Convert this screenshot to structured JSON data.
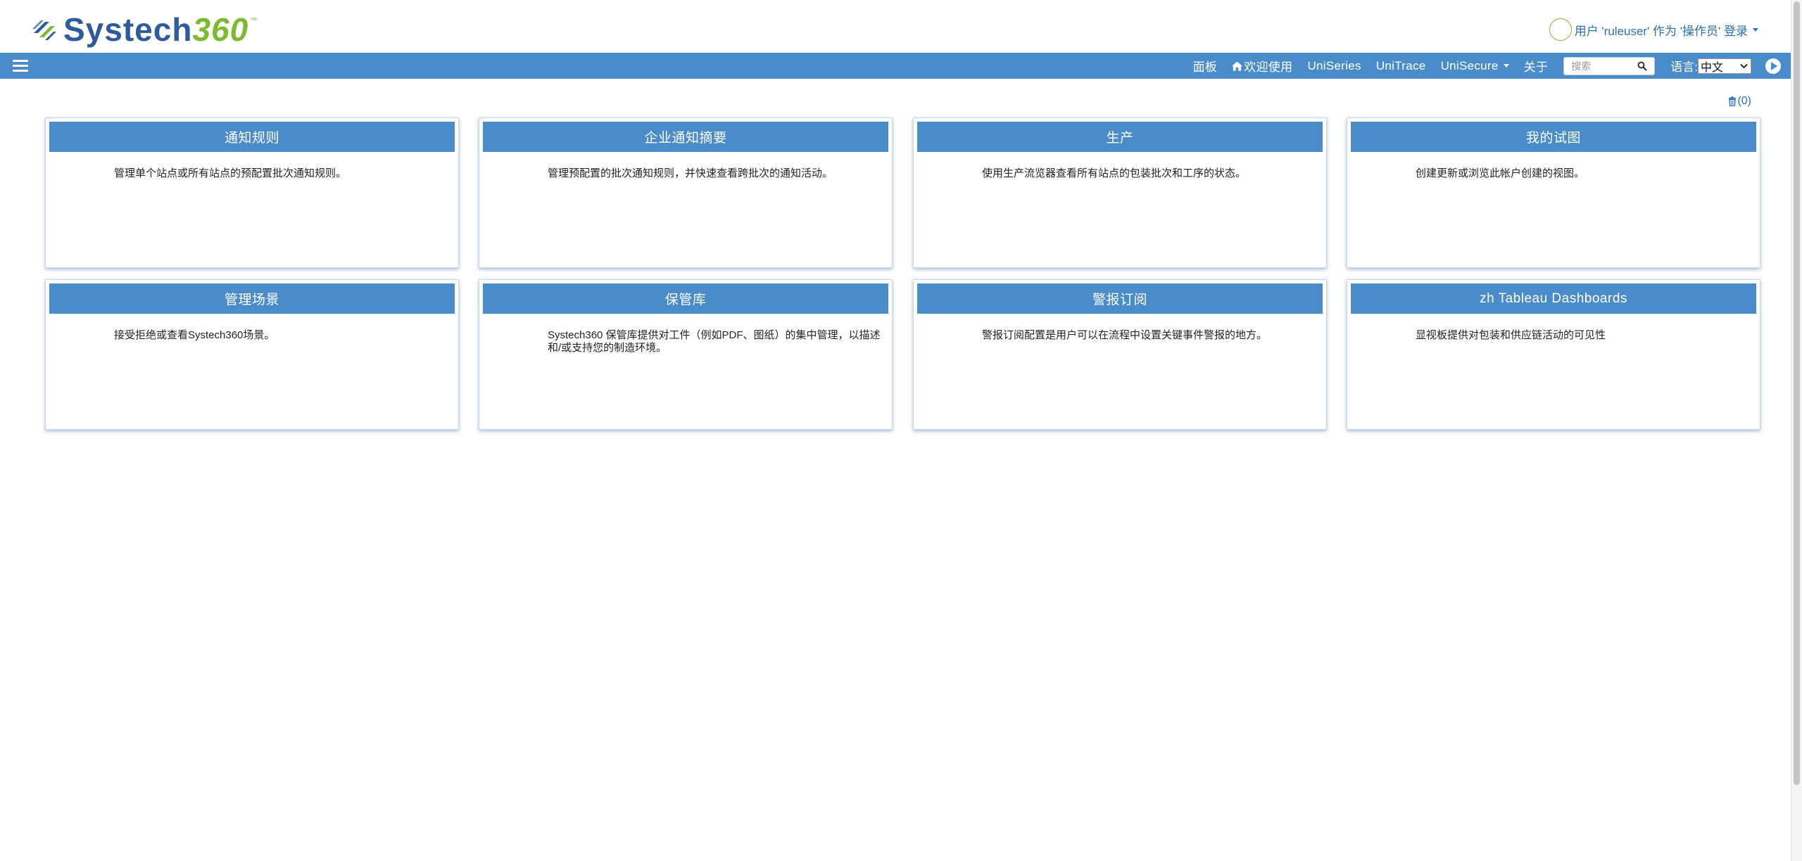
{
  "brand": {
    "name_part1": "Systech",
    "name_part2": "360",
    "trademark": "™",
    "colors": {
      "primary": "#2d5b9b",
      "accent": "#7cbb2f",
      "nav": "#4a8cca"
    }
  },
  "user_menu": {
    "text": "用户 'ruleuser' 作为 '操作员' 登录"
  },
  "nav": {
    "items": [
      {
        "label": "面板",
        "icon": ""
      },
      {
        "label": "欢迎使用",
        "icon": "home-icon"
      },
      {
        "label": "UniSeries",
        "icon": ""
      },
      {
        "label": "UniTrace",
        "icon": ""
      },
      {
        "label": "UniSecure",
        "icon": "",
        "dropdown": true
      },
      {
        "label": "关于",
        "icon": ""
      }
    ],
    "search_placeholder": "搜索",
    "language_label": "语言:",
    "language_value": "中文"
  },
  "alerts": {
    "count_text": "(0)"
  },
  "cards": [
    {
      "title": "通知规则",
      "description": "管理单个站点或所有站点的预配置批次通知规则。"
    },
    {
      "title": "企业通知摘要",
      "description": "管理预配置的批次通知规则，并快速查看跨批次的通知活动。"
    },
    {
      "title": "生产",
      "description": "使用生产流览器查看所有站点的包装批次和工序的状态。"
    },
    {
      "title": "我的试图",
      "description": "创建更新或浏览此帐户创建的视图。"
    },
    {
      "title": "管理场景",
      "description": "接受拒绝或查看Systech360场景。"
    },
    {
      "title": "保管库",
      "description": "Systech360 保管库提供对工件（例如PDF、图纸）的集中管理，以描述和/或支持您的制造环境。"
    },
    {
      "title": "警报订阅",
      "description": "警报订阅配置是用户可以在流程中设置关键事件警报的地方。"
    },
    {
      "title": "zh Tableau Dashboards",
      "description": "显视板提供对包装和供应链活动的可见性"
    }
  ]
}
